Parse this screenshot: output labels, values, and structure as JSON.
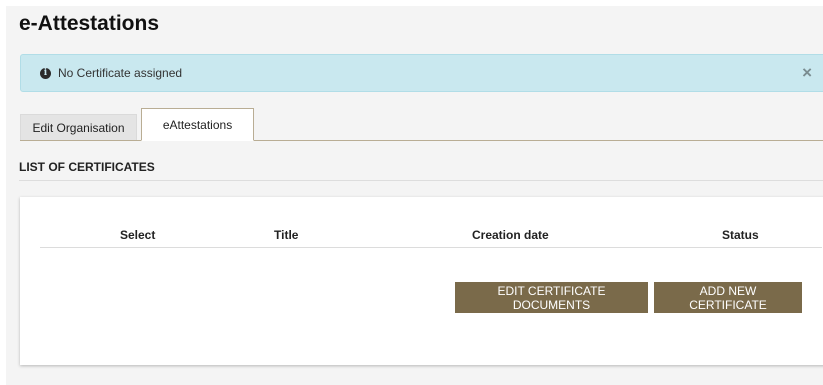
{
  "page": {
    "title": "e-Attestations"
  },
  "alert": {
    "icon": "info-circle-icon",
    "message": "No Certificate assigned",
    "close_label": "×",
    "color": "#c9e8ef"
  },
  "tabs": [
    {
      "label": "Edit Organisation",
      "active": false
    },
    {
      "label": "eAttestations",
      "active": true
    }
  ],
  "section": {
    "title": "LIST OF CERTIFICATES"
  },
  "table": {
    "columns": [
      "Select",
      "Title",
      "Creation date",
      "Status"
    ],
    "rows": []
  },
  "actions": {
    "edit_documents_label": "EDIT CERTIFICATE DOCUMENTS",
    "add_certificate_label": "ADD NEW CERTIFICATE",
    "button_color": "#7a6a4a"
  }
}
